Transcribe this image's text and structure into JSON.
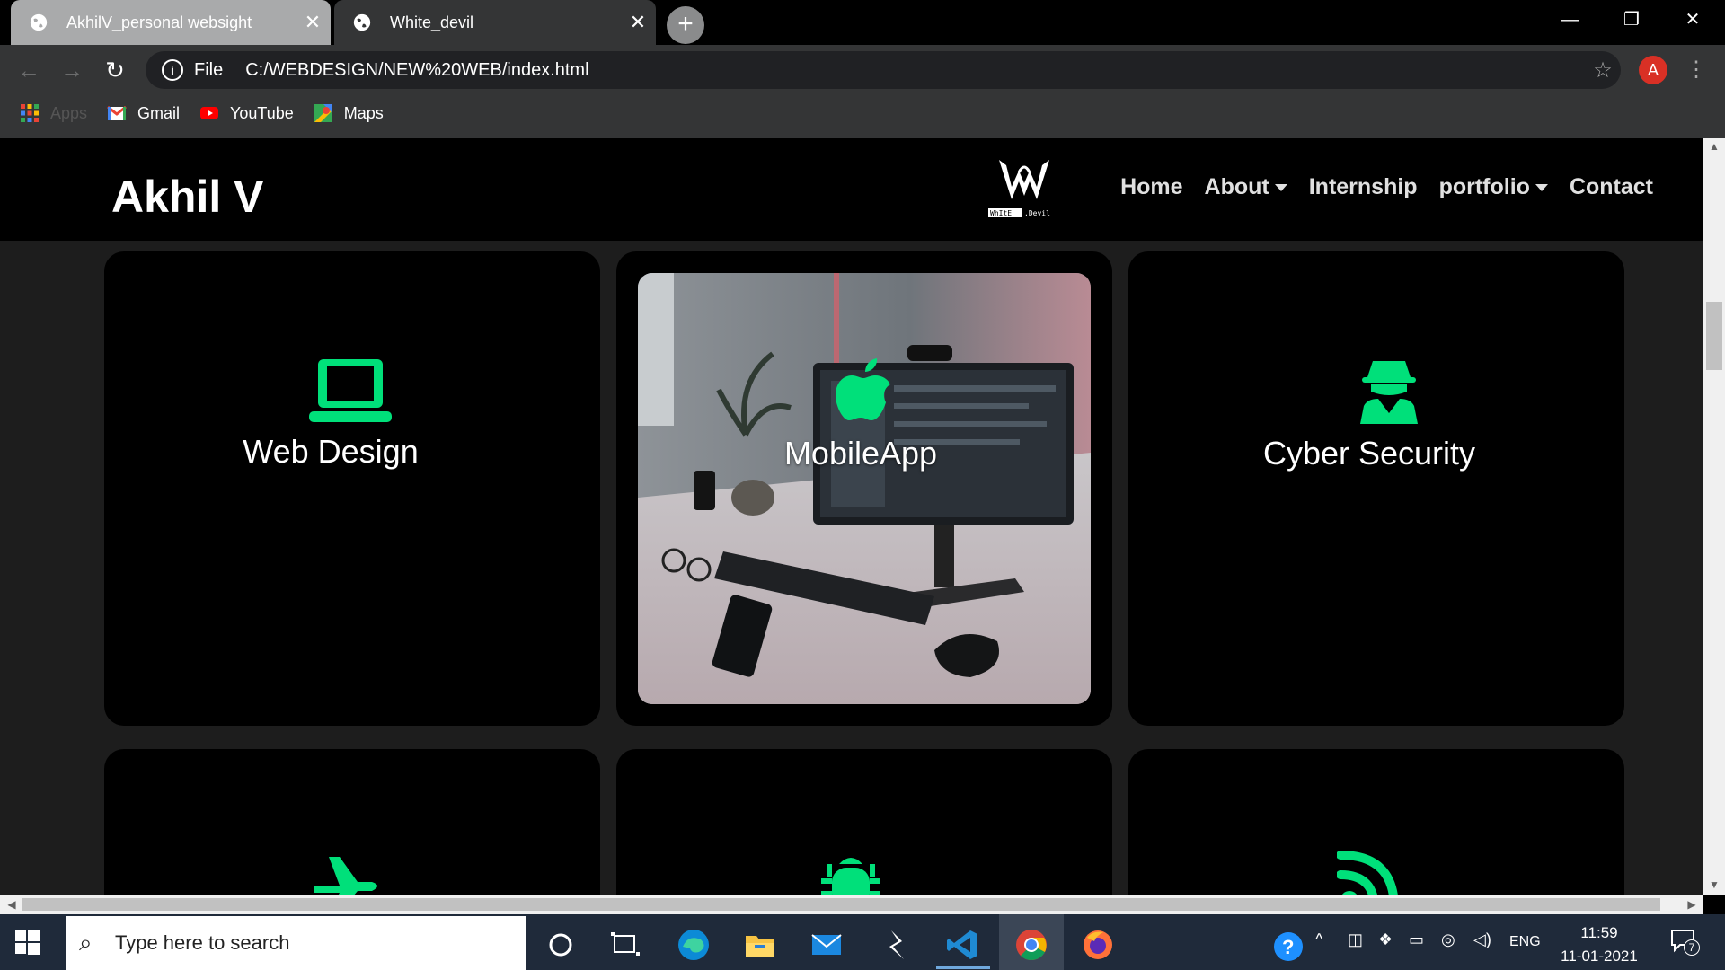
{
  "browser": {
    "tabs": [
      {
        "title": "AkhilV_personal websight",
        "active": false
      },
      {
        "title": "White_devil",
        "active": true
      }
    ],
    "close_glyph": "✕",
    "newtab_glyph": "+",
    "window": {
      "minimize": "—",
      "restore": "❐",
      "close": "✕"
    },
    "scheme_label": "File",
    "url": "C:/WEBDESIGN/NEW%20WEB/index.html",
    "profile_initial": "A",
    "bookmarks": [
      {
        "label": "Apps",
        "icon": "apps-grid-icon"
      },
      {
        "label": "Gmail",
        "icon": "gmail-icon"
      },
      {
        "label": "YouTube",
        "icon": "youtube-icon"
      },
      {
        "label": "Maps",
        "icon": "maps-icon"
      }
    ]
  },
  "site": {
    "brand": "Akhil V",
    "logo_text": "WhItE.Devil",
    "nav": [
      {
        "label": "Home",
        "dropdown": false
      },
      {
        "label": "About",
        "dropdown": true
      },
      {
        "label": "Internship",
        "dropdown": false
      },
      {
        "label": "portfolio",
        "dropdown": true
      },
      {
        "label": "Contact",
        "dropdown": false
      }
    ],
    "accent_color": "#00e07a",
    "services": [
      {
        "title": "Web Design",
        "icon": "laptop-icon"
      },
      {
        "title": "MobileApp",
        "icon": "apple-icon",
        "image": "desk-monitor-photo"
      },
      {
        "title": "Cyber Security",
        "icon": "user-secret-icon"
      },
      {
        "title": "",
        "icon": "plane-icon"
      },
      {
        "title": "",
        "icon": "bug-icon"
      },
      {
        "title": "",
        "icon": "rss-icon"
      }
    ]
  },
  "taskbar": {
    "search_placeholder": "Type here to search",
    "tray": {
      "language": "ENG",
      "time": "11:59",
      "date": "11-01-2021",
      "notifications": "7"
    }
  }
}
